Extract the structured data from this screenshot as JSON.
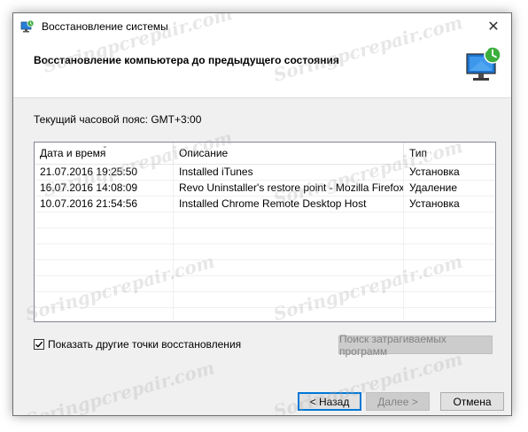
{
  "window": {
    "title": "Восстановление системы",
    "close_glyph": "✕"
  },
  "header": {
    "title": "Восстановление компьютера до предыдущего состояния"
  },
  "timezone_label": "Текущий часовой пояс: GMT+3:00",
  "listview": {
    "columns": [
      "Дата и время",
      "Описание",
      "Тип"
    ],
    "rows": [
      {
        "date": "21.07.2016 19:25:50",
        "description": "Installed iTunes",
        "type": "Установка"
      },
      {
        "date": "16.07.2016 14:08:09",
        "description": "Revo Uninstaller's restore point - Mozilla Firefox ...",
        "type": "Удаление"
      },
      {
        "date": "10.07.2016 21:54:56",
        "description": "Installed Chrome Remote Desktop Host",
        "type": "Установка"
      }
    ]
  },
  "show_more": {
    "label": "Показать другие точки восстановления",
    "checked": true
  },
  "buttons": {
    "scan": "Поиск затрагиваемых программ",
    "back": "< Назад",
    "next": "Далее >",
    "cancel": "Отмена"
  },
  "watermark": "Soringpcrepair.com",
  "icons": {
    "title": "system-restore-icon",
    "header": "monitor-restore-icon",
    "close": "close-icon",
    "check": "checkmark-icon"
  },
  "colors": {
    "accent": "#0078d7",
    "header_bg": "#ffffff",
    "body_bg": "#f0f0f0"
  }
}
